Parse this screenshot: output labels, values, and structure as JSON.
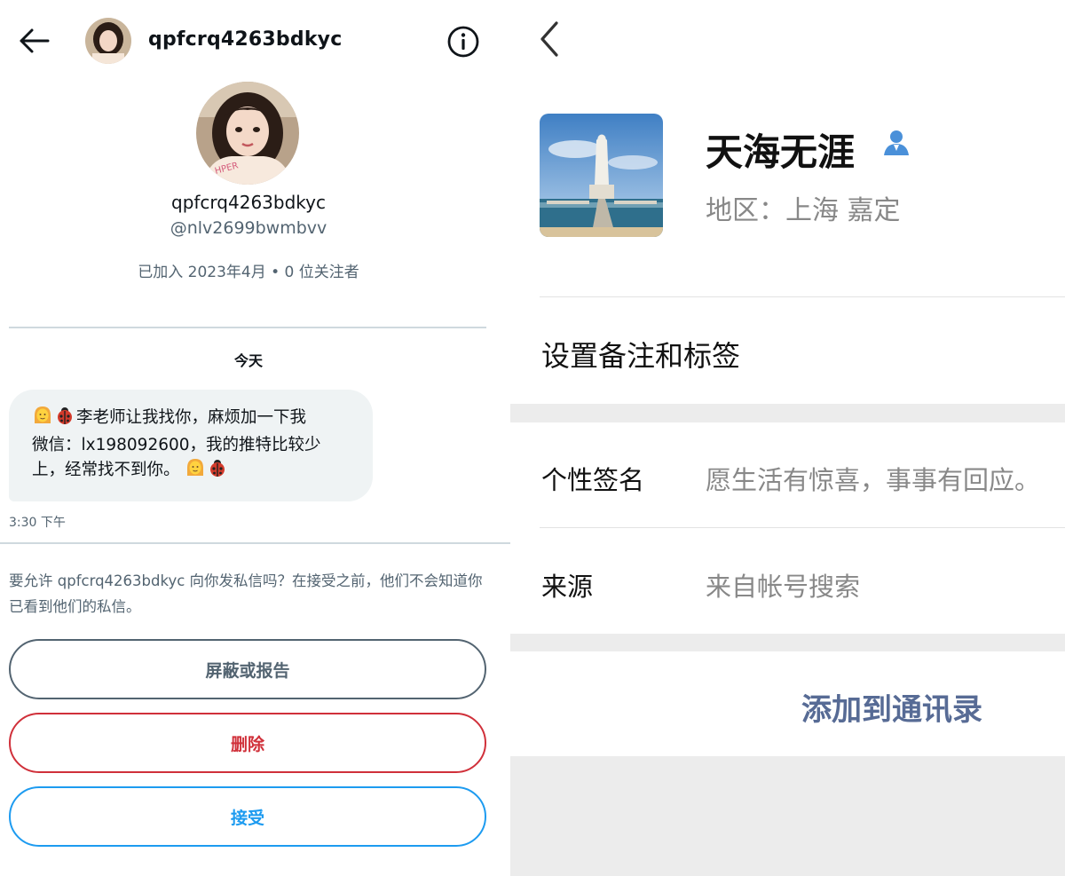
{
  "twitter": {
    "header": {
      "display_name": "qpfcrq4263bdkyc"
    },
    "profile": {
      "name": "qpfcrq4263bdkyc",
      "handle": "@nlv2699bwmbvv",
      "meta": "已加入 2023年4月 • 0 位关注者"
    },
    "day_label": "今天",
    "message": {
      "text_line1": "李老师让我找你，麻烦加一下我",
      "text_line2": "微信：lx198092600，我的推特比较少",
      "text_line3": "上，经常找不到你。",
      "time": "3:30 下午"
    },
    "permission_text": "要允许 qpfcrq4263bdkyc 向你发私信吗？在接受之前，他们不会知道你已看到他们的私信。",
    "buttons": {
      "block": "屏蔽或报告",
      "delete": "删除",
      "accept": "接受"
    },
    "colors": {
      "accent": "#1d9bf0",
      "danger": "#d0303a",
      "muted": "#536471"
    }
  },
  "wechat": {
    "name": "天海无涯",
    "region": "地区：上海  嘉定",
    "remark_label": "设置备注和标签",
    "signature_label": "个性签名",
    "signature_value": "愿生活有惊喜，事事有回应。",
    "source_label": "来源",
    "source_value": "来自帐号搜索",
    "add_contact": "添加到通讯录",
    "colors": {
      "link": "#576b95",
      "gender_icon": "#4a90d9"
    }
  }
}
